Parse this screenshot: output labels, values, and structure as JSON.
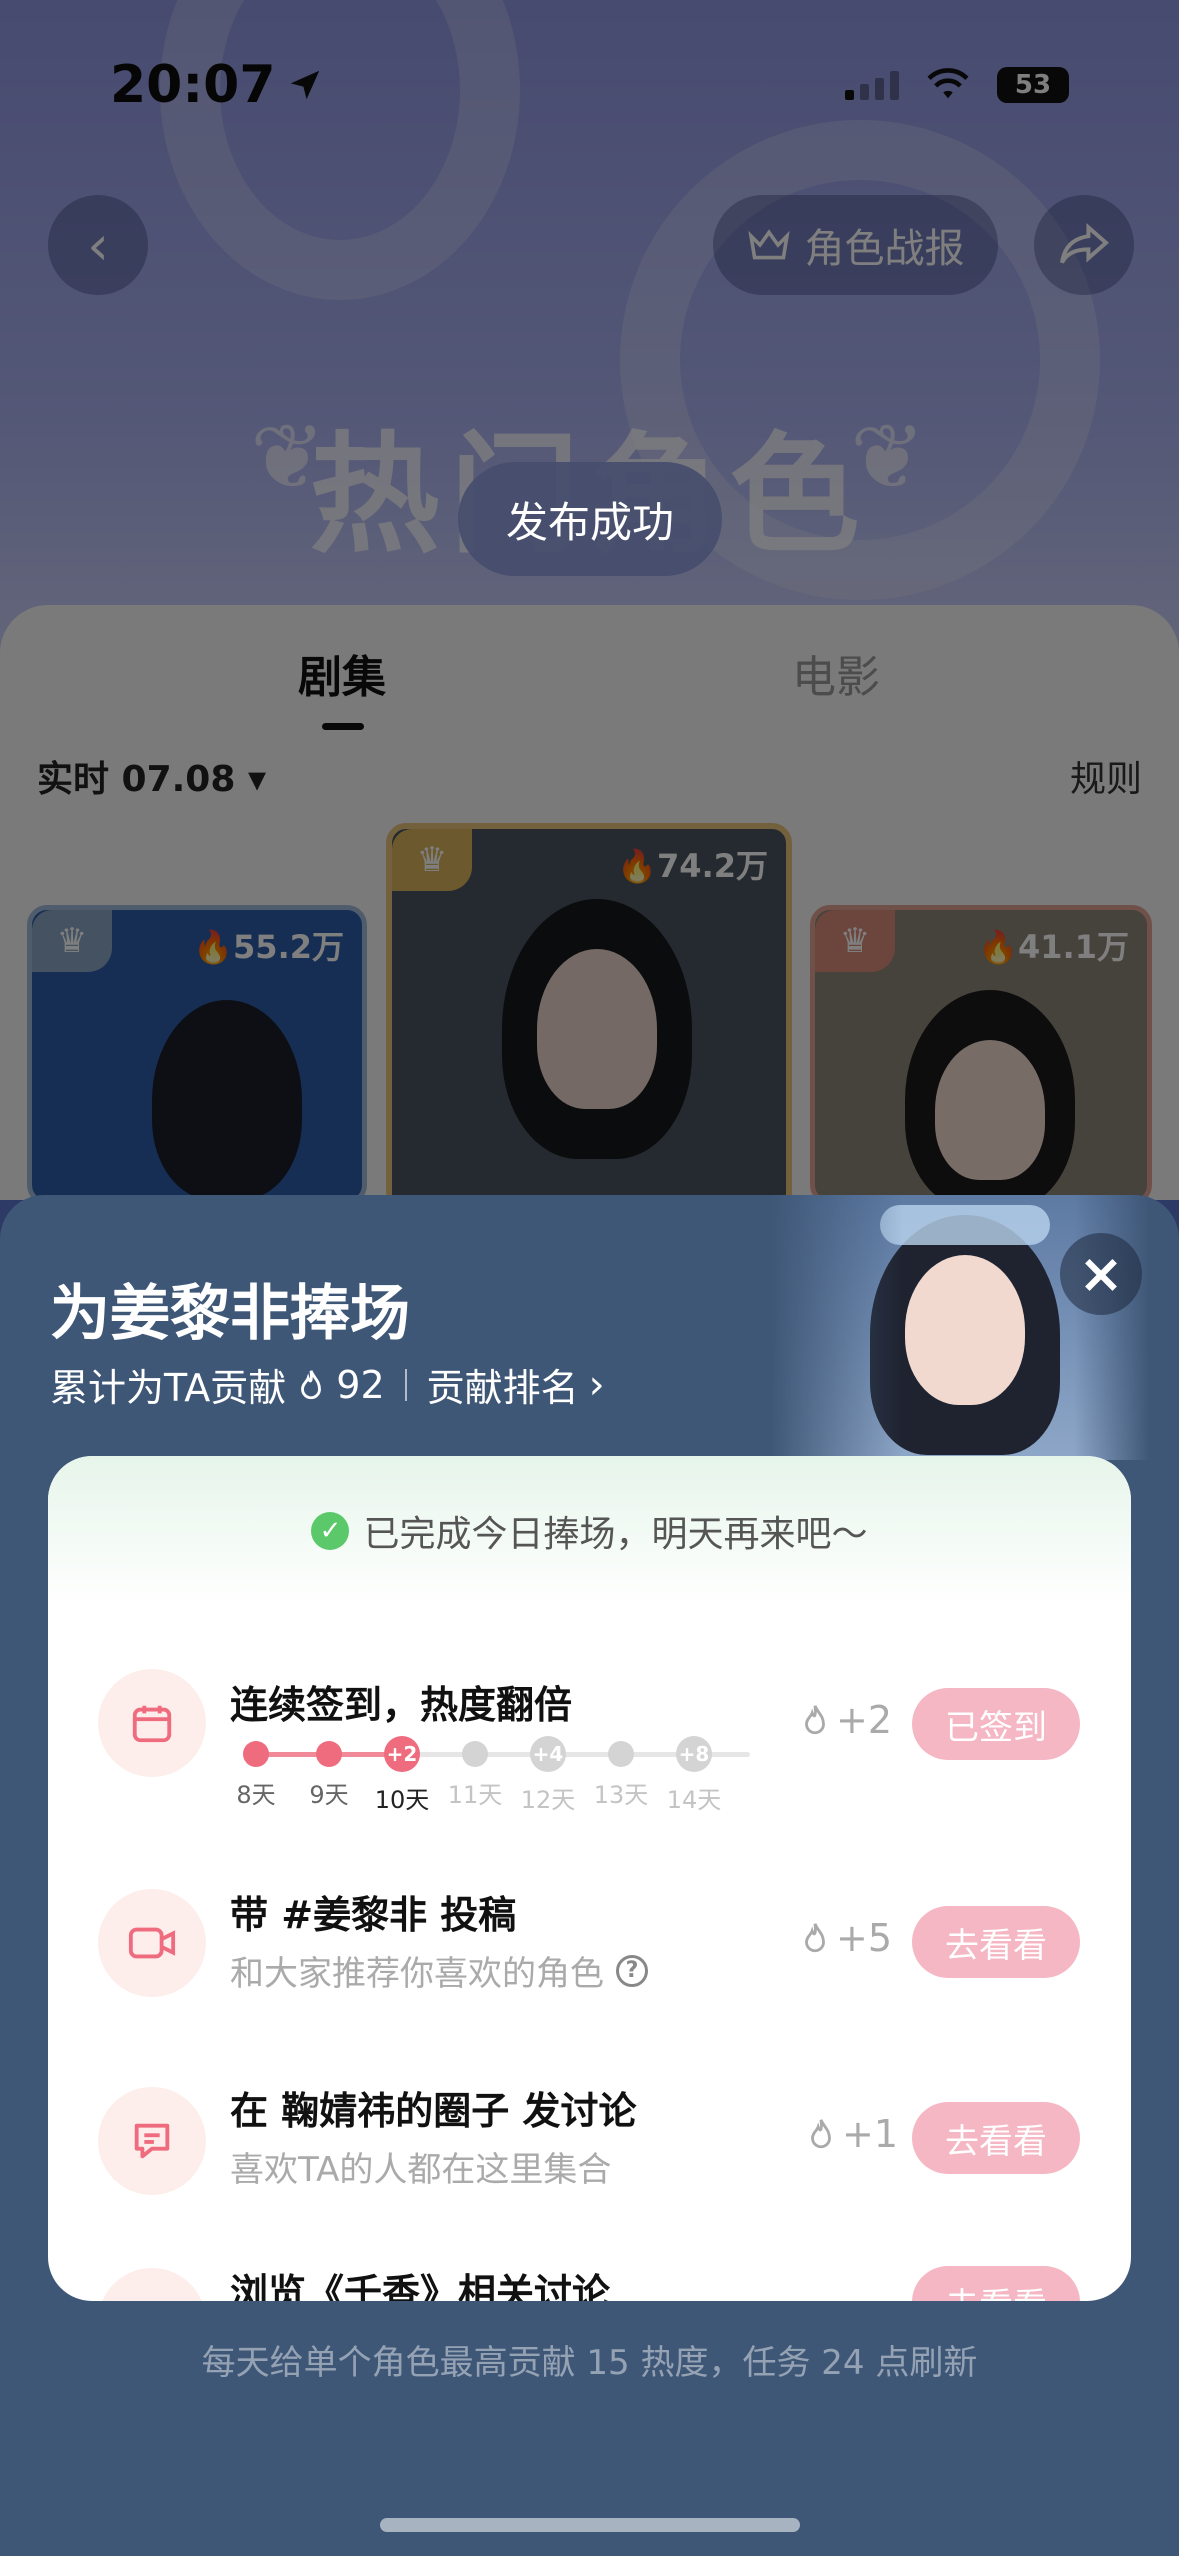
{
  "status_bar": {
    "time": "20:07",
    "battery": "53"
  },
  "header": {
    "report_label": "角色战报"
  },
  "hero": {
    "title": "热门角色"
  },
  "toast": "发布成功",
  "tabs": [
    {
      "label": "剧集",
      "active": true
    },
    {
      "label": "电影",
      "active": false
    }
  ],
  "filter": {
    "date_label": "实时 07.08",
    "rules_label": "规则"
  },
  "ranking": [
    {
      "hot": "74.2万",
      "crown_color": "#d8b25a"
    },
    {
      "hot": "55.2万",
      "crown_color": "#8aa5c4"
    },
    {
      "hot": "41.1万",
      "crown_color": "#d98c7a"
    }
  ],
  "sheet": {
    "title": "为姜黎非捧场",
    "contribution_label": "累计为TA贡献",
    "contribution_value": "92",
    "rank_link": "贡献排名",
    "done_message": "已完成今日捧场，明天再来吧～",
    "footer": "每天给单个角色最高贡献 15 热度，任务 24 点刷新"
  },
  "tasks": [
    {
      "icon": "calendar-icon",
      "title": "连续签到，热度翻倍",
      "points": "+2",
      "button": "已签到",
      "streak": [
        {
          "label": "8天",
          "badge": "",
          "state": "done"
        },
        {
          "label": "9天",
          "badge": "",
          "state": "done"
        },
        {
          "label": "10天",
          "badge": "+2",
          "state": "today"
        },
        {
          "label": "11天",
          "badge": "",
          "state": "future"
        },
        {
          "label": "12天",
          "badge": "+4",
          "state": "future"
        },
        {
          "label": "13天",
          "badge": "",
          "state": "future"
        },
        {
          "label": "14天",
          "badge": "+8",
          "state": "future"
        }
      ]
    },
    {
      "icon": "video-camera-icon",
      "title": "带 #姜黎非 投稿",
      "desc": "和大家推荐你喜欢的角色",
      "points": "+5",
      "button": "去看看"
    },
    {
      "icon": "chat-icon",
      "title": "在 鞠婧祎的圈子 发讨论",
      "desc": "喜欢TA的人都在这里集合",
      "points": "+1",
      "button": "去看看"
    },
    {
      "icon": "browse-icon",
      "title": "浏览《千香》相关讨论",
      "points": "",
      "button": "去看看"
    }
  ],
  "colors": {
    "accent_pink": "#ef6b7e",
    "button_pink": "#f5b7c4",
    "sheet_bg": "#3f5777"
  }
}
